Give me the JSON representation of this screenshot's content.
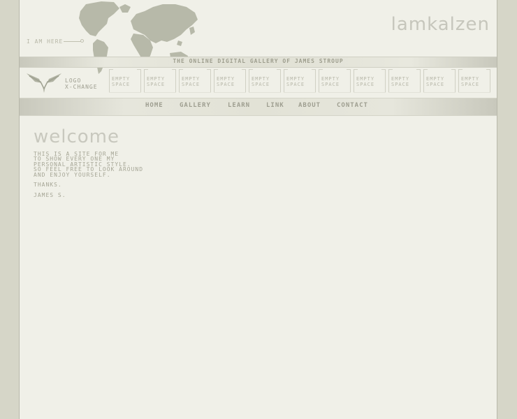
{
  "header": {
    "location_label": "I AM HERE",
    "site_logo": "lamkalzen",
    "tagline": "THE ONLINE DIGITAL GALLERY OF JAMES STROUP"
  },
  "logo_block": {
    "line1": "LOGO",
    "line2": "X-CHANGE"
  },
  "slots": [
    {
      "line1": "EMPTY",
      "line2": "SPACE"
    },
    {
      "line1": "EMPTY",
      "line2": "SPACE"
    },
    {
      "line1": "EMPTY",
      "line2": "SPACE"
    },
    {
      "line1": "EMPTY",
      "line2": "SPACE"
    },
    {
      "line1": "EMPTY",
      "line2": "SPACE"
    },
    {
      "line1": "EMPTY",
      "line2": "SPACE"
    },
    {
      "line1": "EMPTY",
      "line2": "SPACE"
    },
    {
      "line1": "EMPTY",
      "line2": "SPACE"
    },
    {
      "line1": "EMPTY",
      "line2": "SPACE"
    },
    {
      "line1": "EMPTY",
      "line2": "SPACE"
    },
    {
      "line1": "EMPTY",
      "line2": "SPACE"
    }
  ],
  "nav": [
    "HOME",
    "GALLERY",
    "LEARN",
    "LINK",
    "ABOUT",
    "CONTACT"
  ],
  "content": {
    "title": "welcome",
    "body": "THIS IS A SITE FOR ME\nTO SHOW EVERY ONE MY\nPERSONAL ARTISTIC STYLE.\nSO FEEL FREE TO LOOK AROUND\nAND ENJOY YOURSELF.",
    "thanks": "THANKS.",
    "signature": "JAMES S."
  },
  "colors": {
    "outer_background": "#d6d6c8",
    "page_background": "#f0f0e8",
    "text": "#a6a696",
    "map": "#b7b9a9"
  },
  "icons": [
    "world-map",
    "winged-logo-icon"
  ]
}
